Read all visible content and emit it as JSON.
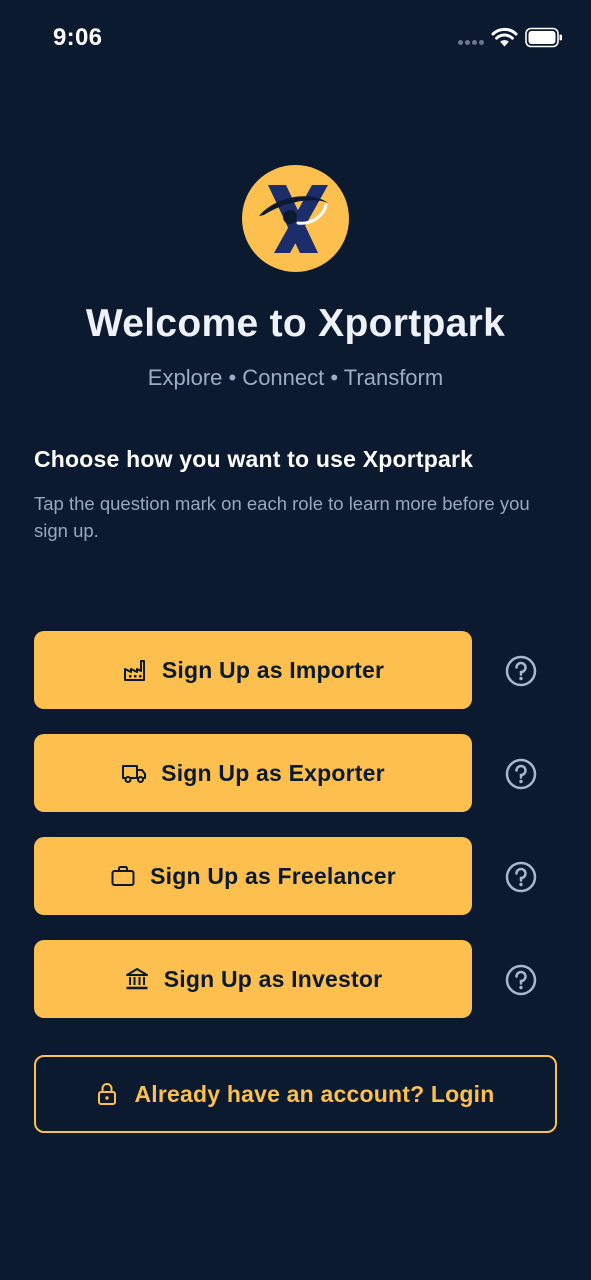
{
  "status_bar": {
    "time": "9:06",
    "icons": [
      "signal-icon",
      "wifi-icon",
      "battery-icon"
    ]
  },
  "header": {
    "logo": "xportpark-logo",
    "title": "Welcome to Xportpark",
    "tagline": "Explore • Connect • Transform"
  },
  "intro": {
    "heading": "Choose how you want to use Xportpark",
    "description": "Tap the question mark on each role to learn more before you sign up."
  },
  "roles": [
    {
      "label": "Sign Up as Importer",
      "icon": "factory-icon",
      "help_icon": "help-circle-icon"
    },
    {
      "label": "Sign Up as Exporter",
      "icon": "truck-icon",
      "help_icon": "help-circle-icon"
    },
    {
      "label": "Sign Up as Freelancer",
      "icon": "briefcase-icon",
      "help_icon": "help-circle-icon"
    },
    {
      "label": "Sign Up as Investor",
      "icon": "bank-icon",
      "help_icon": "help-circle-icon"
    }
  ],
  "login": {
    "label": "Already have an account? Login",
    "icon": "lock-icon"
  },
  "colors": {
    "background": "#0b1a2f",
    "accent": "#fdc04f",
    "muted_text": "#9aa8bd",
    "help_icon": "#a9b6cc"
  }
}
